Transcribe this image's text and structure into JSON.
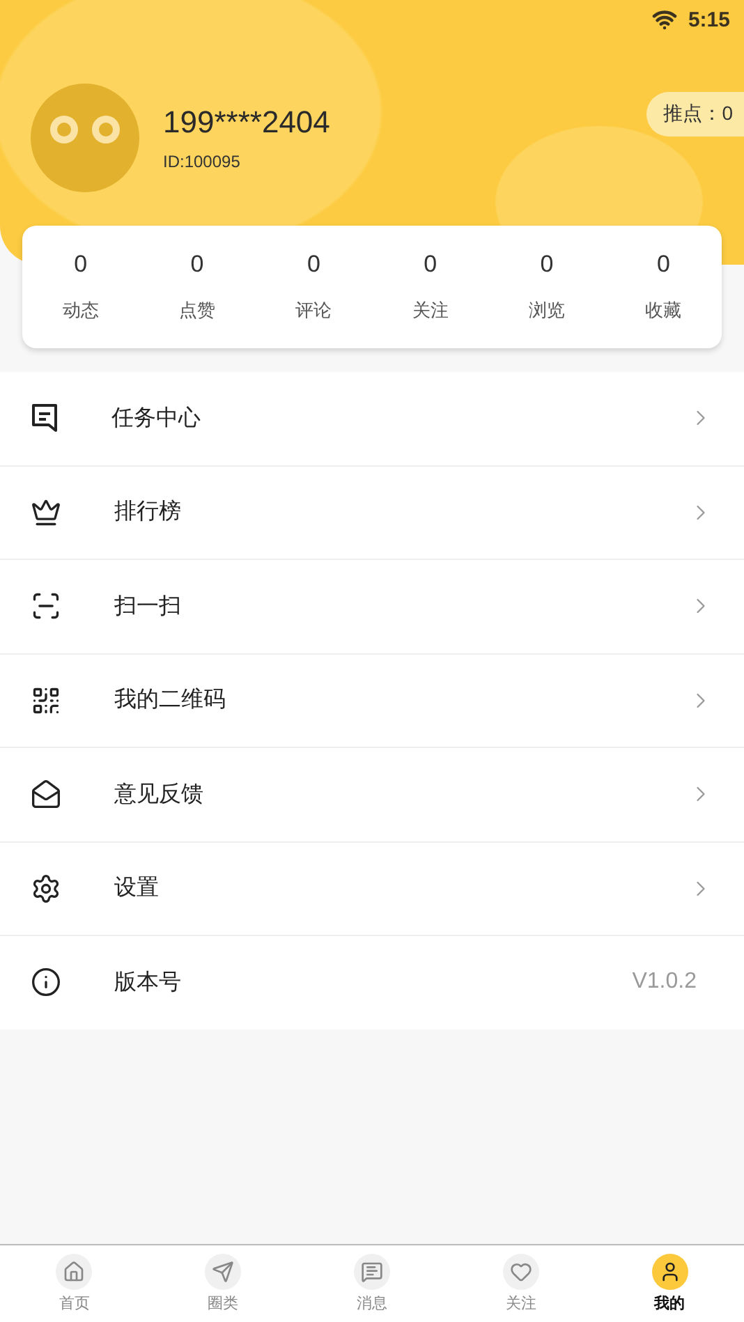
{
  "status_bar": {
    "time": "5:15"
  },
  "profile": {
    "name": "199****2404",
    "id": "ID:100095",
    "points": "推点：0"
  },
  "stats": [
    {
      "value": "0",
      "label": "动态"
    },
    {
      "value": "0",
      "label": "点赞"
    },
    {
      "value": "0",
      "label": "评论"
    },
    {
      "value": "0",
      "label": "关注"
    },
    {
      "value": "0",
      "label": "浏览"
    },
    {
      "value": "0",
      "label": "收藏"
    }
  ],
  "menu": [
    {
      "kind": "link",
      "label": "任务中心"
    },
    {
      "kind": "link",
      "label": "排行榜"
    },
    {
      "kind": "link",
      "label": "扫一扫"
    },
    {
      "kind": "link",
      "label": "我的二维码"
    },
    {
      "kind": "link",
      "label": "意见反馈"
    },
    {
      "kind": "link",
      "label": "设置"
    },
    {
      "kind": "info",
      "label": "版本号",
      "value": "V1.0.2"
    }
  ],
  "tabs": [
    {
      "label": "首页",
      "selected": false
    },
    {
      "label": "圈类",
      "selected": false
    },
    {
      "label": "消息",
      "selected": false
    },
    {
      "label": "关注",
      "selected": false
    },
    {
      "label": "我的",
      "selected": true
    }
  ]
}
